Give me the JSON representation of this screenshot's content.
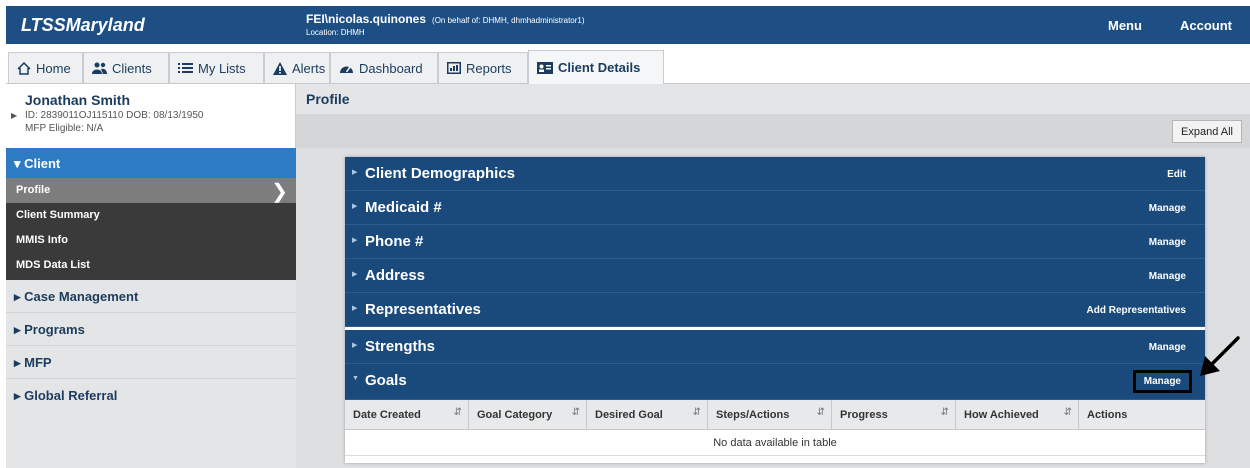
{
  "header": {
    "brand": "LTSSMaryland",
    "user": "FEI\\nicolas.quinones",
    "on_behalf": "(On behalf of: DHMH, dhmhadministrator1)",
    "location": "Location: DHMH",
    "menu_label": "Menu",
    "account_label": "Account"
  },
  "tabs": [
    {
      "label": "Home",
      "icon": "home-icon"
    },
    {
      "label": "Clients",
      "icon": "users-icon"
    },
    {
      "label": "My Lists",
      "icon": "list-icon"
    },
    {
      "label": "Alerts",
      "icon": "warning-icon"
    },
    {
      "label": "Dashboard",
      "icon": "dashboard-icon"
    },
    {
      "label": "Reports",
      "icon": "report-icon"
    },
    {
      "label": "Client Details",
      "icon": "client-card-icon"
    }
  ],
  "client": {
    "name": "Jonathan Smith",
    "id_dob": "ID: 2839011OJ115110 DOB: 08/13/1950",
    "mfp": "MFP Eligible: N/A"
  },
  "sidebar": {
    "section": "Client",
    "sub_items": [
      "Profile",
      "Client Summary",
      "MMIS Info",
      "MDS Data List"
    ],
    "items": [
      "Case Management",
      "Programs",
      "MFP",
      "Global Referral"
    ]
  },
  "page": {
    "title": "Profile",
    "expand_all": "Expand All"
  },
  "sections": [
    {
      "label": "Client Demographics",
      "action": "Edit"
    },
    {
      "label": "Medicaid #",
      "action": "Manage"
    },
    {
      "label": "Phone #",
      "action": "Manage"
    },
    {
      "label": "Address",
      "action": "Manage"
    },
    {
      "label": "Representatives",
      "action": "Add Representatives"
    },
    {
      "label": "Strengths",
      "action": "Manage"
    },
    {
      "label": "Goals",
      "action": "Manage"
    }
  ],
  "goals_table": {
    "columns": [
      "Date Created",
      "Goal Category",
      "Desired Goal",
      "Steps/Actions",
      "Progress",
      "How Achieved",
      "Actions"
    ],
    "empty_message": "No data available in table"
  },
  "colors": {
    "header_bg": "#1d4f85",
    "accordion_bg": "#1a4a7c",
    "sidebar_active": "#2d7cc3"
  }
}
